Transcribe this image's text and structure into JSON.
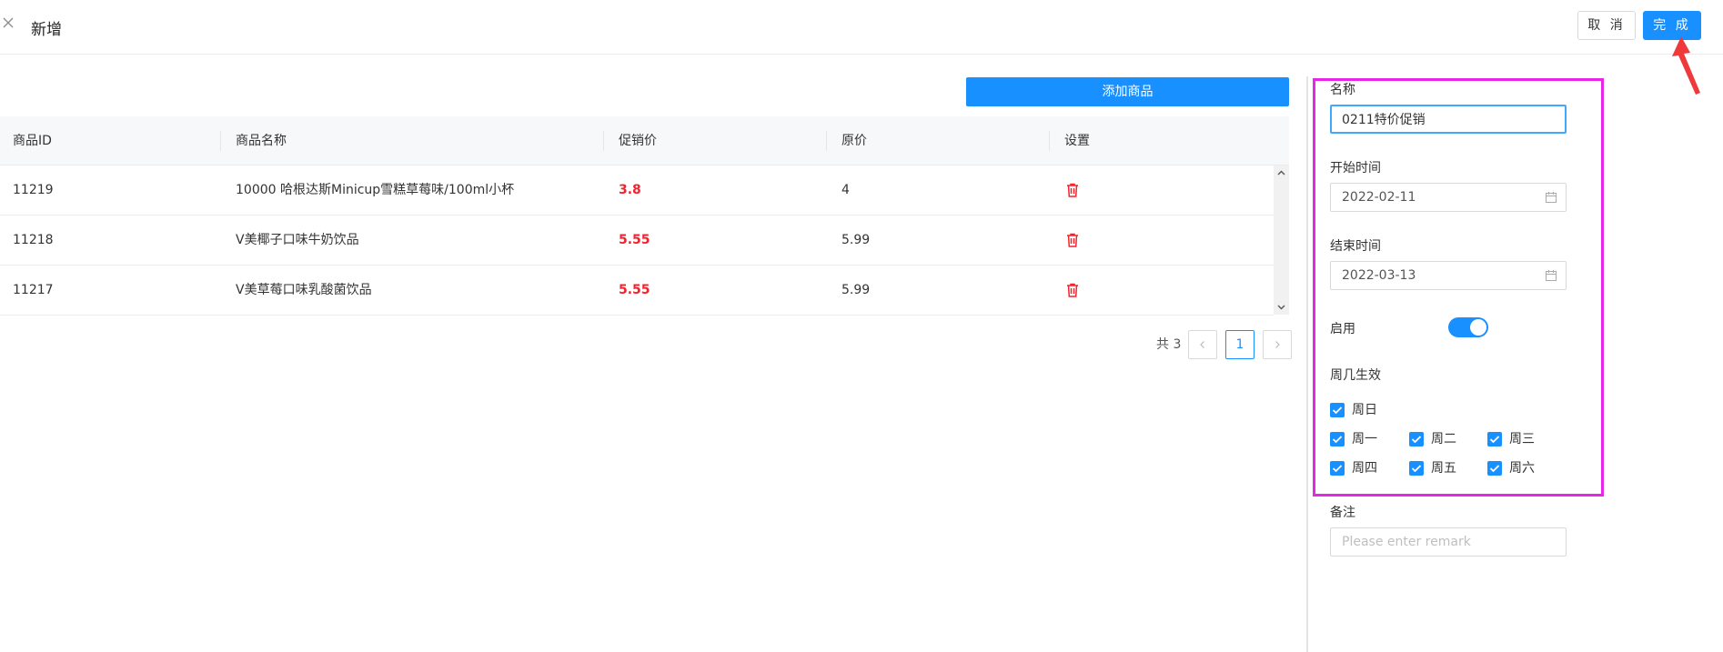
{
  "header": {
    "close_icon": "close-icon",
    "title": "新增",
    "cancel_label": "取 消",
    "done_label": "完 成"
  },
  "toolbar": {
    "add_product_label": "添加商品"
  },
  "table": {
    "columns": [
      "商品ID",
      "商品名称",
      "促销价",
      "原价",
      "设置"
    ],
    "rows": [
      {
        "id": "11219",
        "name": "10000 哈根达斯Minicup雪糕草莓味/100ml小杯",
        "promo_price": "3.8",
        "original_price": "4",
        "action_icon": "trash-icon"
      },
      {
        "id": "11218",
        "name": "V美椰子口味牛奶饮品",
        "promo_price": "5.55",
        "original_price": "5.99",
        "action_icon": "trash-icon"
      },
      {
        "id": "11217",
        "name": "V美草莓口味乳酸菌饮品",
        "promo_price": "5.55",
        "original_price": "5.99",
        "action_icon": "trash-icon"
      }
    ],
    "promo_color": "#f5222d"
  },
  "pagination": {
    "total": "共 3",
    "prev": "<",
    "current": "1",
    "next": ">"
  },
  "form": {
    "name_label": "名称",
    "name_value": "0211特价促销",
    "start_label": "开始时间",
    "start_value": "2022-02-11",
    "end_label": "结束时间",
    "end_value": "2022-03-13",
    "enable_label": "启用",
    "enabled": true,
    "weekday_label": "周几生效",
    "days": [
      {
        "label": "周日",
        "checked": true
      },
      {
        "label": "周一",
        "checked": true
      },
      {
        "label": "周二",
        "checked": true
      },
      {
        "label": "周三",
        "checked": true
      },
      {
        "label": "周四",
        "checked": true
      },
      {
        "label": "周五",
        "checked": true
      },
      {
        "label": "周六",
        "checked": true
      }
    ],
    "remark_label": "备注",
    "remark_placeholder": "Please enter remark"
  },
  "colors": {
    "primary": "#1890ff",
    "highlight_box": "#e628e6",
    "arrow": "#ee3a3a"
  }
}
